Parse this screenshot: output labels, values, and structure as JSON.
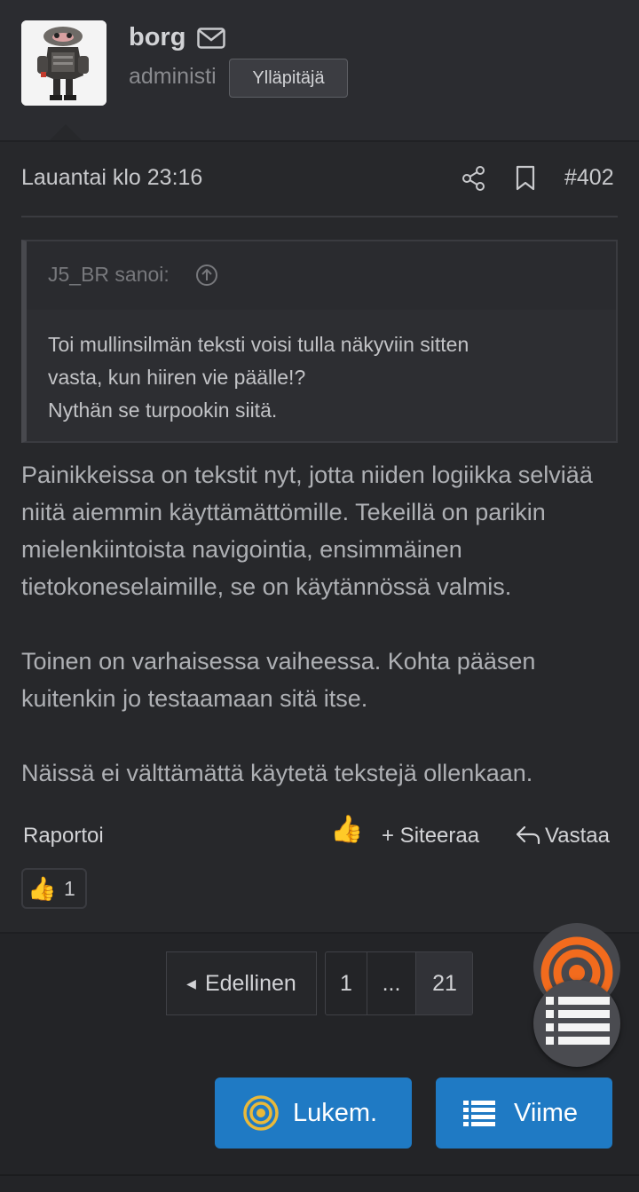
{
  "author": {
    "username": "borg",
    "user_title": "administi",
    "role_badge": "Ylläpitäjä",
    "avatar_icon": "raccoon-avatar",
    "mail_icon": "envelope-icon"
  },
  "post": {
    "date": "Lauantai klo 23:16",
    "number": "#402",
    "quote": {
      "author": "J5_BR sanoi:",
      "lines": [
        "Toi mullinsilmän teksti voisi tulla näkyviin sitten",
        "vasta, kun hiiren vie päälle!?",
        "Nythän se turpookin siitä."
      ]
    },
    "paragraphs": [
      "Painikkeissa on tekstit nyt, jotta niiden logiikka selviää niitä aiemmin käyttämättömille. Tekeillä on parikin mielenkiintoista navigointia, ensimmäinen tietokoneselaimille, se on käytännössä valmis.",
      "Toinen on varhaisessa vaiheessa. Kohta pääsen kuitenkin jo testaamaan sitä itse.",
      "Näissä ei välttämättä käytetä tekstejä ollenkaan."
    ],
    "actions": {
      "report": "Raportoi",
      "like_emoji": "👍",
      "quote": "+ Siteeraa",
      "reply": "Vastaa"
    },
    "reactions": {
      "emoji": "👍",
      "count": "1"
    }
  },
  "pagination": {
    "prev": "Edellinen",
    "pages": [
      "1",
      "...",
      "21"
    ]
  },
  "nav_buttons": {
    "reading": "Lukem.",
    "latest": "Viime"
  },
  "colors": {
    "background": "#27282b",
    "accent_blue": "#1f7ac4",
    "rss_orange": "#f26b1d",
    "target_yellow": "#e9b93a"
  }
}
